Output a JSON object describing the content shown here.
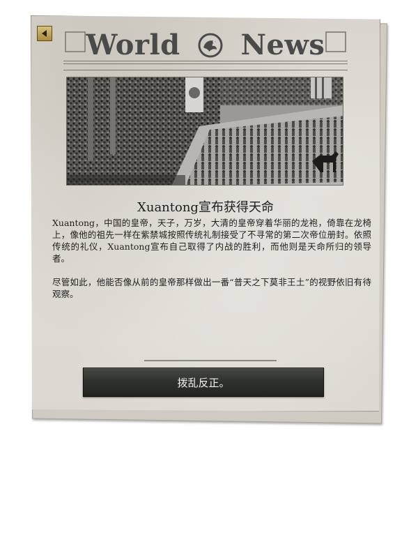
{
  "masthead": {
    "title_left": "World",
    "title_right": "News",
    "emblem_icon": "dragon-emblem-icon"
  },
  "photo": {
    "description_icon": "parade-photo"
  },
  "headline": "Xuantong宣布获得天命",
  "article": {
    "paragraphs": [
      "Xuantong，中国的皇帝，天子，万岁，大清的皇帝穿着华丽的龙袍，倚靠在龙椅上，像他的祖先一样在紫禁城按照传统礼制接受了不寻常的第二次帝位册封。依照传统的礼仪，Xuantong宣布自己取得了内战的胜利，而他则是天命所归的领导者。",
      "尽管如此，他能否像从前的皇帝那样做出一番“普天之下莫非王土”的视野依旧有待观察。"
    ]
  },
  "action_button": {
    "label": "拨乱反正。"
  },
  "colors": {
    "paper": "#dcd8d1",
    "ink": "#1e1e1e",
    "button_dark": "#2e302a",
    "back_button_gold": "#c0a55a"
  }
}
